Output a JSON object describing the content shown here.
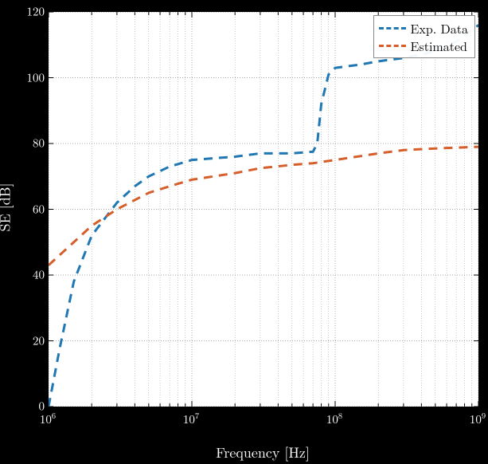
{
  "chart_data": {
    "type": "line",
    "title": "",
    "xlabel": "Frequency [Hz]",
    "ylabel": "SE [dB]",
    "x_scale": "log",
    "xlim": [
      1000000.0,
      1000000000.0
    ],
    "ylim": [
      0,
      120
    ],
    "x_ticks": [
      1000000.0,
      10000000.0,
      100000000.0,
      1000000000.0
    ],
    "x_tick_labels": [
      "10^6",
      "10^7",
      "10^8",
      "10^9"
    ],
    "y_ticks": [
      0,
      20,
      40,
      60,
      80,
      100,
      120
    ],
    "grid": {
      "major": true,
      "minor": true
    },
    "legend_position": "upper right",
    "series": [
      {
        "name": "Exp. Data",
        "color": "#1f77b4",
        "style": "dashed",
        "x": [
          1000000.0,
          1200000.0,
          1500000.0,
          2000000.0,
          3000000.0,
          4000000.0,
          5000000.0,
          7000000.0,
          10000000.0,
          20000000.0,
          30000000.0,
          50000000.0,
          70000000.0,
          75000000.0,
          80000000.0,
          90000000.0,
          100000000.0,
          150000000.0,
          200000000.0,
          300000000.0,
          500000000.0,
          700000000.0,
          1000000000.0
        ],
        "y": [
          0,
          18,
          38,
          52,
          62,
          67,
          70,
          73,
          75,
          76,
          77,
          77,
          77.5,
          80,
          92,
          101,
          103,
          104,
          105,
          106,
          108,
          111,
          116
        ]
      },
      {
        "name": "Estimated",
        "color": "#d55e2b",
        "style": "dashed",
        "x": [
          1000000.0,
          1500000.0,
          2000000.0,
          3000000.0,
          5000000.0,
          7000000.0,
          10000000.0,
          20000000.0,
          30000000.0,
          50000000.0,
          70000000.0,
          100000000.0,
          200000000.0,
          300000000.0,
          500000000.0,
          1000000000.0
        ],
        "y": [
          43,
          50,
          55,
          60,
          65,
          67,
          69,
          71,
          72.5,
          73.5,
          74,
          75,
          77,
          78,
          78.5,
          79
        ]
      }
    ]
  }
}
